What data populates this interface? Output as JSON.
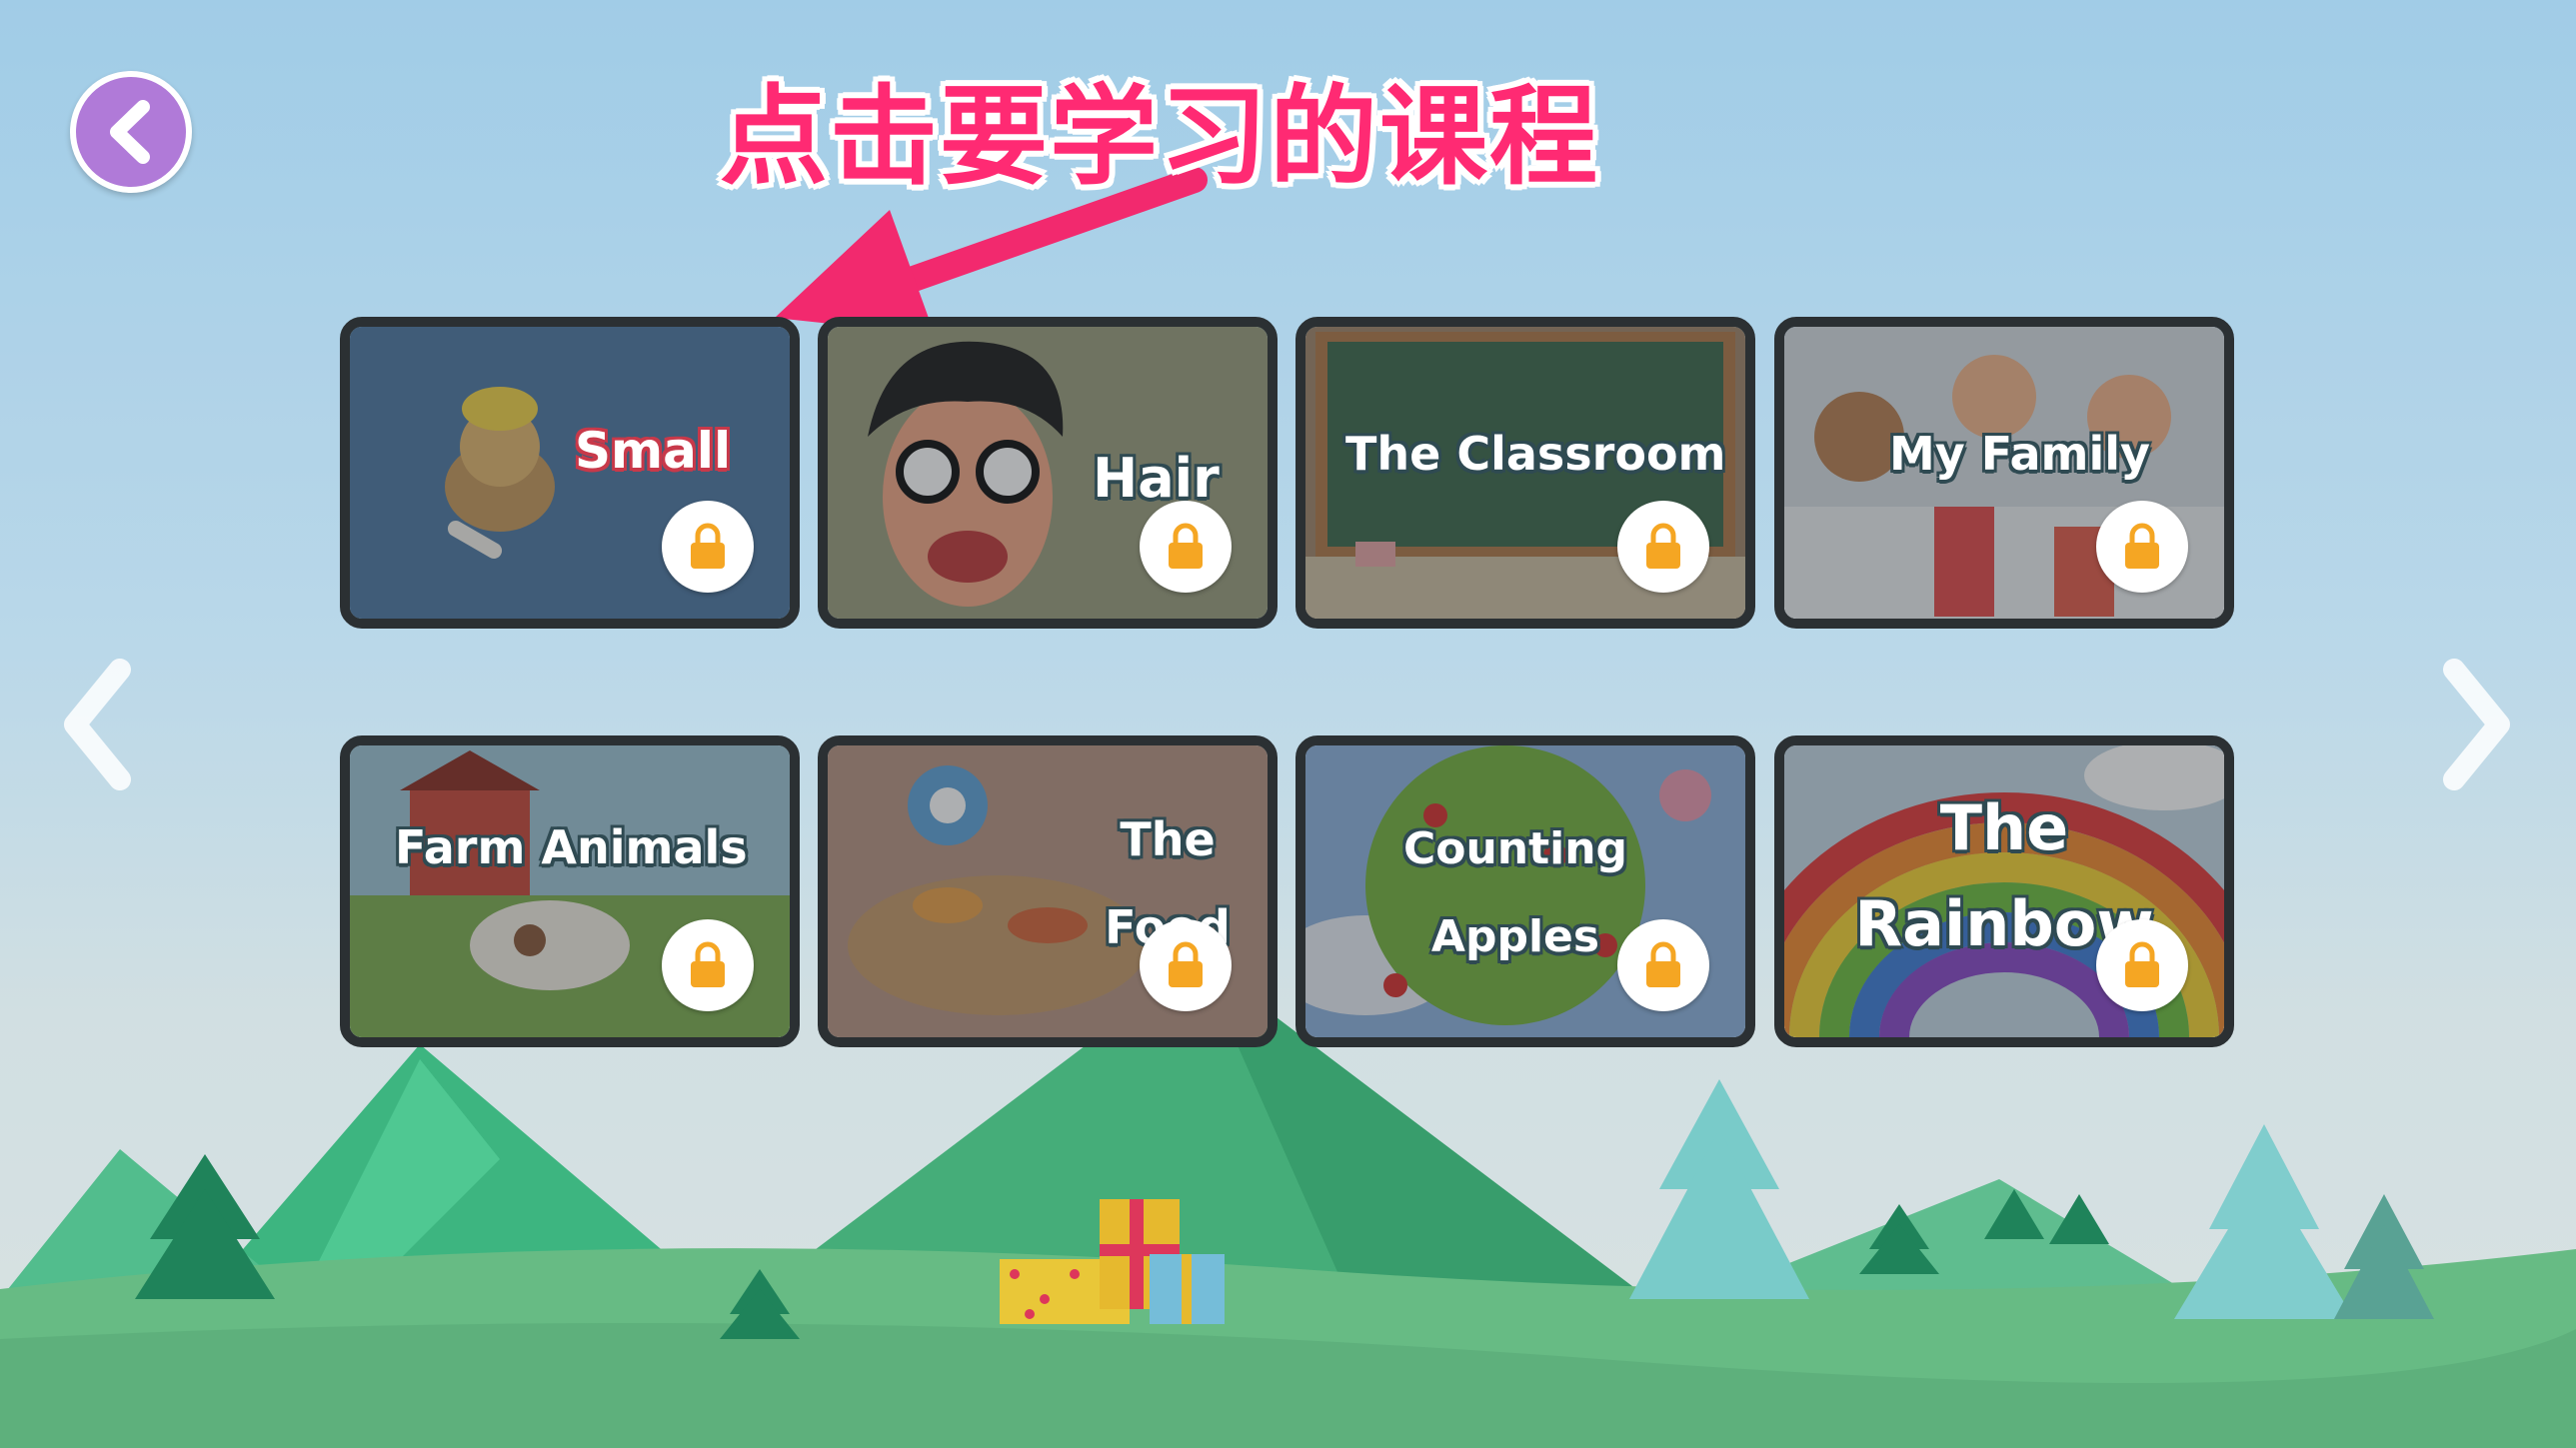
{
  "header": {
    "hint_text": "点击要学习的课程"
  },
  "courses": [
    {
      "title": "Small",
      "locked": true
    },
    {
      "title": "Hair",
      "locked": true
    },
    {
      "title": "The Classroom",
      "locked": true
    },
    {
      "title": "My Family",
      "locked": true
    },
    {
      "title": "Farm Animals",
      "locked": true
    },
    {
      "title": "The Food",
      "locked": true
    },
    {
      "title": "Counting Apples",
      "locked": true
    },
    {
      "title": "The Rainbow",
      "locked": true
    }
  ],
  "icons": {
    "back": "chevron-left-icon",
    "prev_page": "chevron-left-icon",
    "next_page": "chevron-right-icon",
    "lock": "lock-icon"
  },
  "colors": {
    "hint_text": "#ff2a73",
    "back_button": "#b07ad8",
    "lock_icon": "#f5a623",
    "card_border": "#2b3033"
  }
}
